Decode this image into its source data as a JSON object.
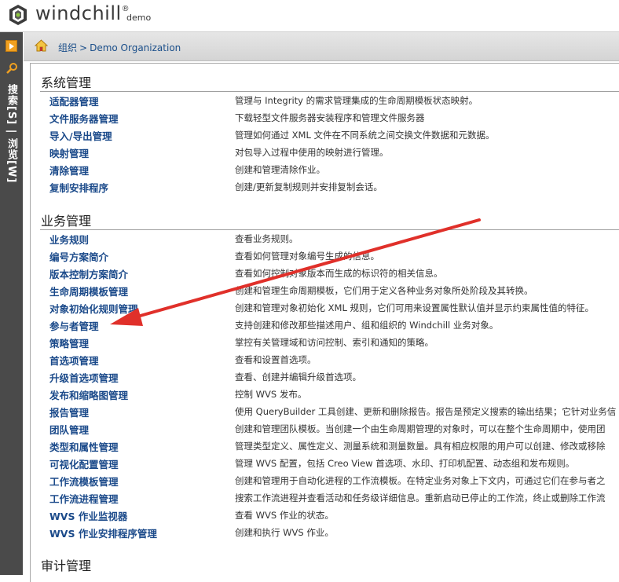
{
  "header": {
    "logo_text": "windchill",
    "logo_mark": "®",
    "org_name": "demo"
  },
  "left_bar": {
    "vertical_label": "搜索[S] | 浏览[W]"
  },
  "breadcrumb": {
    "root": "组织",
    "separator": ">",
    "current": "Demo Organization"
  },
  "sections": {
    "system": {
      "title": "系统管理",
      "items": [
        {
          "name": "适配器管理",
          "desc": "管理与 Integrity 的需求管理集成的生命周期模板状态映射。"
        },
        {
          "name": "文件服务器管理",
          "desc": "下载轻型文件服务器安装程序和管理文件服务器"
        },
        {
          "name": "导入/导出管理",
          "desc": "管理如何通过 XML 文件在不同系统之间交换文件数据和元数据。"
        },
        {
          "name": "映射管理",
          "desc": "对包导入过程中使用的映射进行管理。"
        },
        {
          "name": "清除管理",
          "desc": "创建和管理清除作业。"
        },
        {
          "name": "复制安排程序",
          "desc": "创建/更新复制规则并安排复制会话。"
        }
      ]
    },
    "business": {
      "title": "业务管理",
      "items": [
        {
          "name": "业务规则",
          "desc": "查看业务规则。"
        },
        {
          "name": "编号方案简介",
          "desc": "查看如何管理对象编号生成的信息。"
        },
        {
          "name": "版本控制方案简介",
          "desc": "查看如何控制对象版本而生成的标识符的相关信息。"
        },
        {
          "name": "生命周期模板管理",
          "desc": "创建和管理生命周期模板，它们用于定义各种业务对象所处阶段及其转换。"
        },
        {
          "name": "对象初始化规则管理",
          "desc": "创建和管理对象初始化 XML 规则，它们可用来设置属性默认值并显示约束属性值的特征。"
        },
        {
          "name": "参与者管理",
          "desc": "支持创建和修改那些描述用户、组和组织的 Windchill 业务对象。"
        },
        {
          "name": "策略管理",
          "desc": "掌控有关管理域和访问控制、索引和通知的策略。"
        },
        {
          "name": "首选项管理",
          "desc": "查看和设置首选项。"
        },
        {
          "name": "升级首选项管理",
          "desc": "查看、创建并编辑升级首选项。"
        },
        {
          "name": "发布和缩略图管理",
          "desc": "控制 WVS 发布。"
        },
        {
          "name": "报告管理",
          "desc": "使用 QueryBuilder 工具创建、更新和删除报告。报告是预定义搜索的输出结果；它针对业务信"
        },
        {
          "name": "团队管理",
          "desc": "创建和管理团队模板。当创建一个由生命周期管理的对象时，可以在整个生命周期中，使用团"
        },
        {
          "name": "类型和属性管理",
          "desc": "管理类型定义、属性定义、测量系统和测量数量。具有相应权限的用户可以创建、修改或移除"
        },
        {
          "name": "可视化配置管理",
          "desc": "管理 WVS 配置，包括 Creo View 首选项、水印、打印机配置、动态组和发布规则。"
        },
        {
          "name": "工作流模板管理",
          "desc": "创建和管理用于自动化进程的工作流模板。在特定业务对象上下文内，可通过它们在参与者之"
        },
        {
          "name": "工作流进程管理",
          "desc": "搜索工作流进程并查看活动和任务级详细信息。重新启动已停止的工作流，终止或删除工作流"
        },
        {
          "name": "WVS 作业监视器",
          "desc": "查看 WVS 作业的状态。"
        },
        {
          "name": "WVS 作业安排程序管理",
          "desc": "创建和执行 WVS 作业。"
        }
      ]
    },
    "audit": {
      "title": "审计管理"
    }
  },
  "colors": {
    "link": "#1b4a8a",
    "annotation_arrow": "#e0302a",
    "sidebar": "#4a4a4a"
  }
}
